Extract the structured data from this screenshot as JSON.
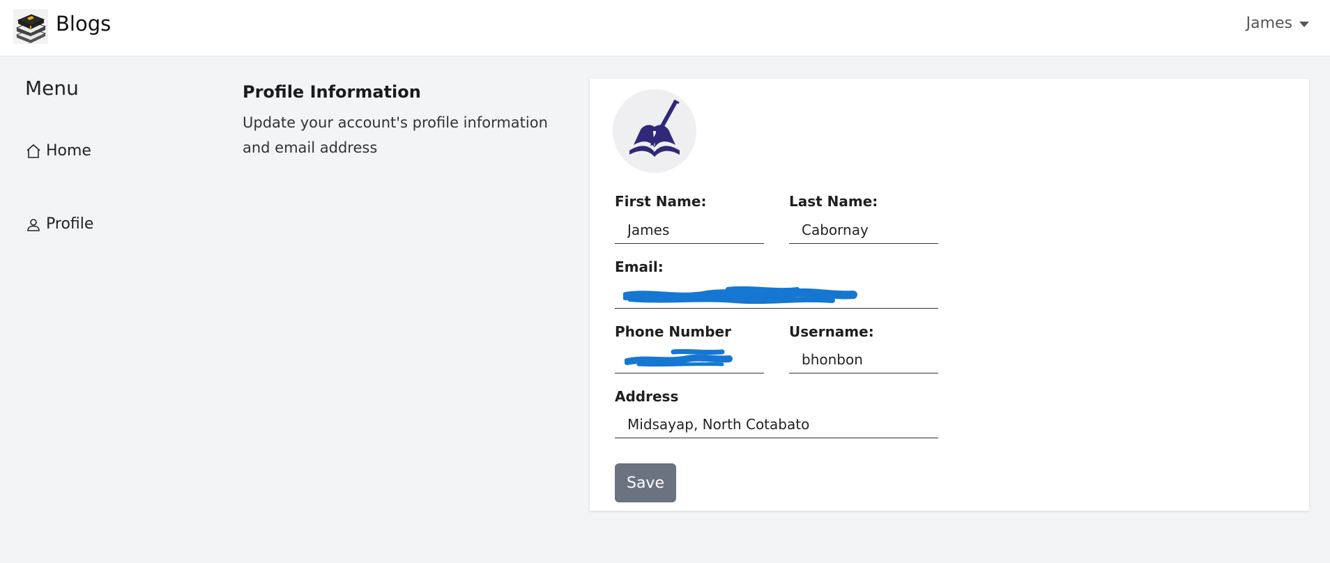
{
  "header": {
    "brand_title": "Blogs",
    "brand_icon": "books-icon",
    "user_name": "James"
  },
  "sidebar": {
    "title": "Menu",
    "items": [
      {
        "label": "Home",
        "icon": "home-icon"
      },
      {
        "label": "Profile",
        "icon": "user-icon"
      }
    ]
  },
  "profile_section": {
    "title": "Profile Information",
    "description": "Update your account's profile information and email address"
  },
  "form": {
    "avatar_icon": "book-pen-icon",
    "first_name": {
      "label": "First Name:",
      "value": "James"
    },
    "last_name": {
      "label": "Last Name:",
      "value": "Cabornay"
    },
    "email": {
      "label": "Email:",
      "value": ""
    },
    "phone": {
      "label": "Phone Number",
      "value": ""
    },
    "username": {
      "label": "Username:",
      "value": "bhonbon"
    },
    "address": {
      "label": "Address",
      "value": "Midsayap, North Cotabato"
    },
    "save_label": "Save"
  },
  "colors": {
    "accent_purple": "#2e2a78",
    "redaction_blue": "#1677d2",
    "save_button": "#6b7280"
  }
}
